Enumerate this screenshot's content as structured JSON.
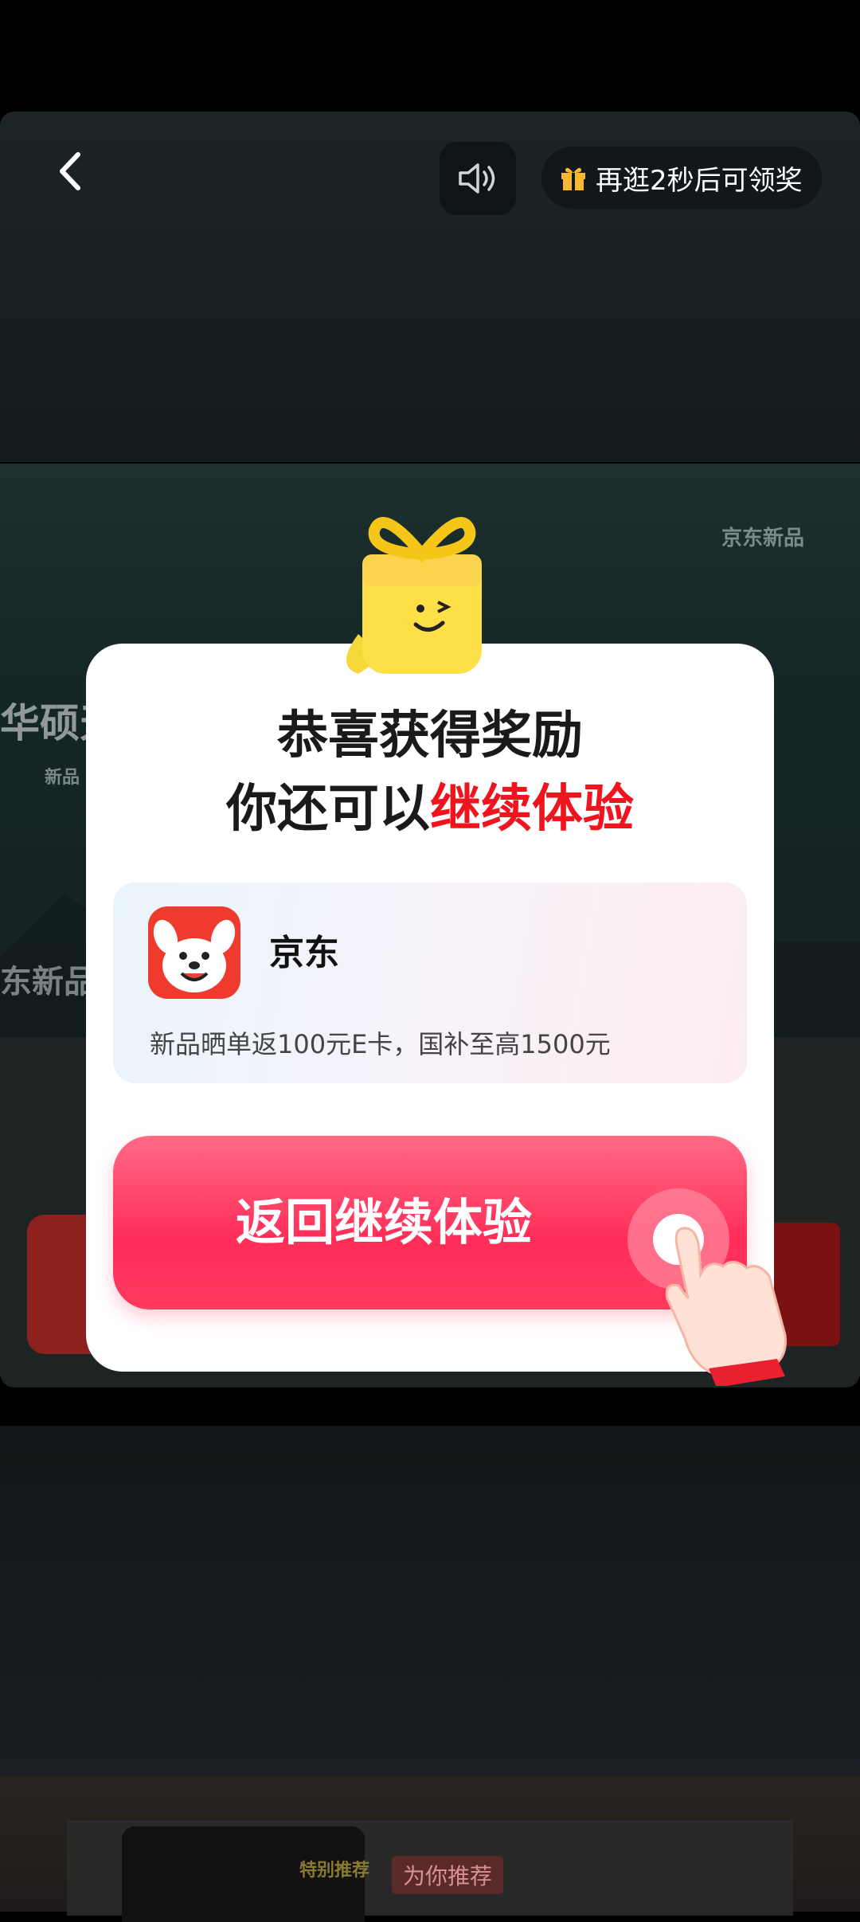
{
  "header": {
    "reward_countdown": "再逛2秒后可领奖",
    "back_icon": "chevron-left-icon",
    "sound_icon": "speaker-icon",
    "gift_icon": "gift-icon"
  },
  "background": {
    "brand_text": "京东新品",
    "brand_text_left": "东新品",
    "partial_title": "华硕天",
    "partial_tag": "新品",
    "recommend_tag": "为你推荐",
    "thumb_tag": "特别推荐"
  },
  "modal": {
    "title_line1": "恭喜获得奖励",
    "title_line2_prefix": "你还可以",
    "title_line2_accent": "继续体验",
    "accent_color": "#f0141e",
    "app": {
      "name": "京东",
      "description": "新品晒单返100元E卡，国补至高1500元",
      "icon": "jd-dog-icon"
    },
    "cta_label": "返回继续体验",
    "cta_color": "#ff2d58"
  }
}
